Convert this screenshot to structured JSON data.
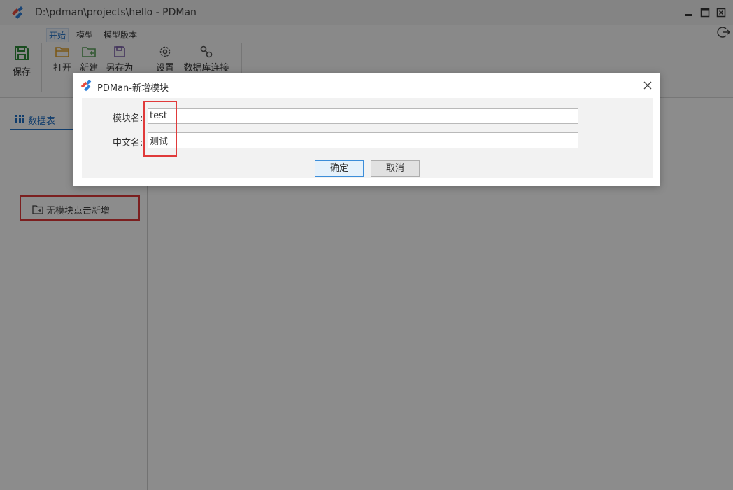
{
  "window": {
    "title": "D:\\pdman\\projects\\hello - PDMan"
  },
  "ribbon": {
    "tabs": [
      {
        "label": "开始",
        "active": true
      },
      {
        "label": "模型",
        "active": false
      },
      {
        "label": "模型版本",
        "active": false
      }
    ],
    "save_label": "保存",
    "tools": [
      {
        "label": "打开",
        "icon": "folder-open-icon"
      },
      {
        "label": "新建",
        "icon": "folder-add-icon"
      },
      {
        "label": "另存为",
        "icon": "save-as-icon"
      },
      {
        "label": "设置",
        "icon": "gear-icon"
      },
      {
        "label": "数据库连接",
        "icon": "link-icon"
      }
    ]
  },
  "sidebar": {
    "tab_label": "数据表",
    "empty_action": "无模块点击新增"
  },
  "dialog": {
    "title": "PDMan-新增模块",
    "module_name_label": "模块名:",
    "module_name_value": "test",
    "chinese_name_label": "中文名:",
    "chinese_name_value": "测试",
    "ok_label": "确定",
    "cancel_label": "取消"
  },
  "colors": {
    "accent": "#1f6fc5",
    "highlight": "#e03a3a",
    "overlay": "#000000"
  }
}
